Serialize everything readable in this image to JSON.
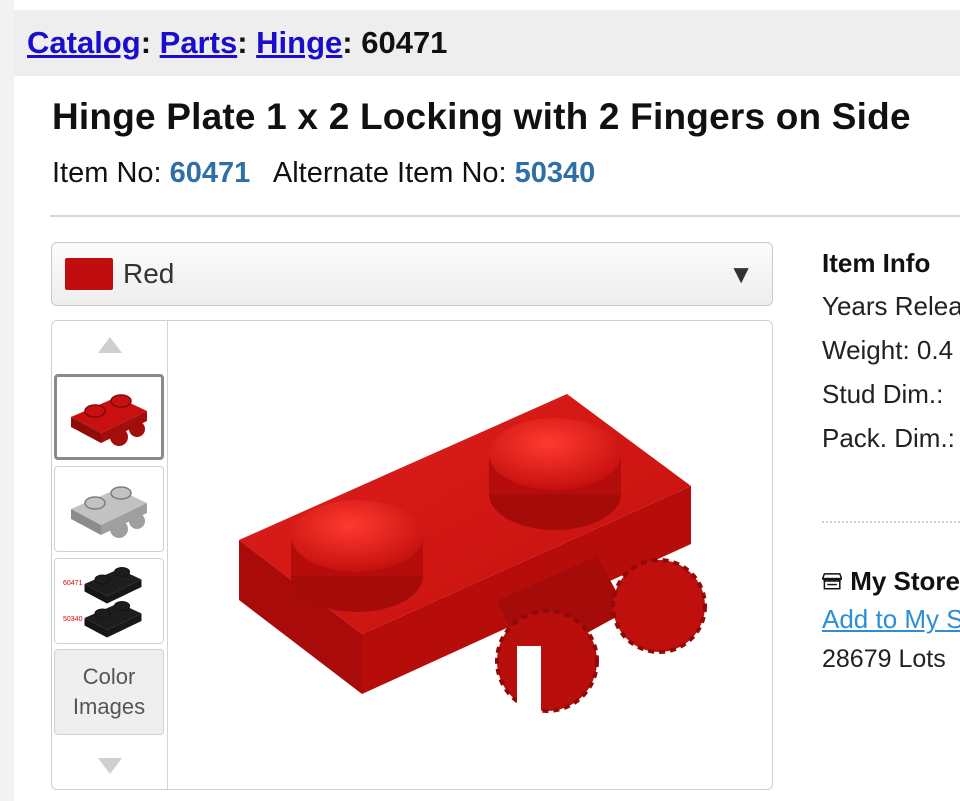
{
  "breadcrumb": {
    "items": [
      "Catalog",
      "Parts",
      "Hinge"
    ],
    "current": "60471",
    "separator": ":"
  },
  "item": {
    "title": "Hinge Plate 1 x 2 Locking with 2 Fingers on Side",
    "item_no_label": "Item No:",
    "item_no": "60471",
    "alt_item_no_label": "Alternate Item No:",
    "alt_item_no": "50340"
  },
  "color_select": {
    "selected": "Red",
    "swatch_color": "#c10d0d",
    "caret": "▼"
  },
  "thumbnails": {
    "color_images_label_line1": "Color",
    "color_images_label_line2": "Images",
    "colors": [
      "#c7100f",
      "#c2c2c2",
      "#1d1d1d"
    ],
    "legend_labels": [
      "60471",
      "50340"
    ]
  },
  "item_info": {
    "heading": "Item Info",
    "rows": [
      "Years Released:",
      "Weight: 0.4",
      "Stud Dim.:",
      "Pack. Dim.:"
    ]
  },
  "my_store": {
    "heading": "My Store",
    "icon": "store-icon",
    "link": "Add to My Store",
    "lots": "28679 Lots"
  },
  "colors": {
    "link": "#1a0dcc",
    "item_number": "#2f6fa8",
    "store_link": "#2c8fd3",
    "brick_red": "#c7100f"
  }
}
